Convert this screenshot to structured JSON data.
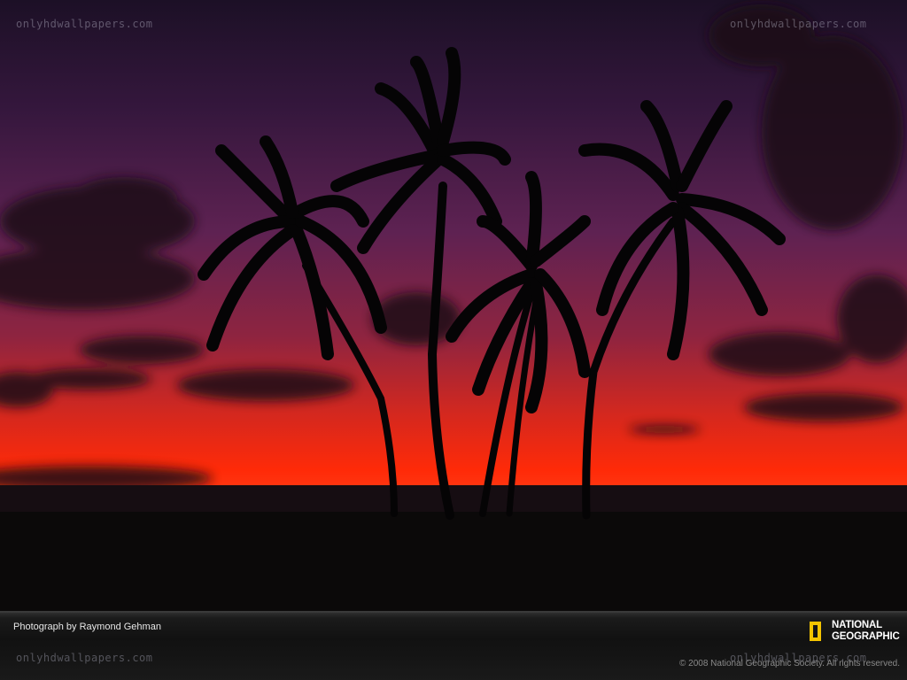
{
  "watermark": {
    "top_left": "onlyhdwallpapers.com",
    "top_right": "onlyhdwallpapers.com",
    "bottom_left": "onlyhdwallpapers.com",
    "bottom_right": "onlyhdwallpapers.com"
  },
  "footer": {
    "credit": "Photograph by Raymond Gehman",
    "copyright": "© 2008 National Geographic Society. All rights reserved."
  },
  "logo": {
    "line1": "NATIONAL",
    "line2": "GEOGRAPHIC",
    "border_color": "#f4c400"
  },
  "scene": {
    "subject": "palm-tree-silhouettes-at-sunset",
    "sky_colors": [
      "#2a1436",
      "#5a2250",
      "#b22a34",
      "#ff2a10"
    ]
  }
}
